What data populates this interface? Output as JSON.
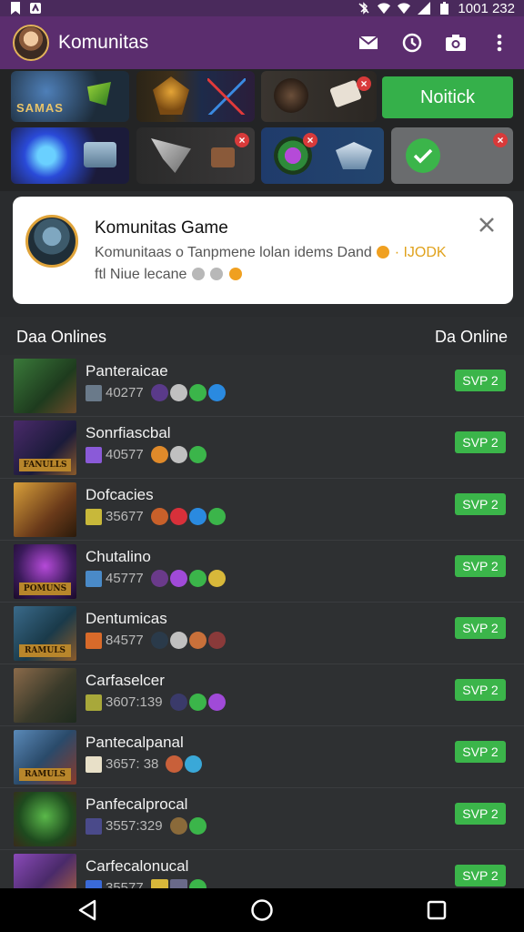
{
  "status_bar": {
    "time": "1001 232",
    "colors": {
      "bg": "#4a2a5c"
    }
  },
  "app_bar": {
    "title": "Komunitas",
    "icons": [
      "mail-icon",
      "clock-icon",
      "camera-icon",
      "more-vert-icon"
    ]
  },
  "tiles": {
    "first_label": "SAMAS",
    "action_button": "Noitick"
  },
  "notification": {
    "title": "Komunitas Game",
    "line1": "Komunitaas o Tanpmene lolan idems Dand",
    "line1_accent": "· IJODK",
    "line2": "ftl  Niue lecane"
  },
  "list_header": {
    "left": "Daa Onlines",
    "right": "Da Online"
  },
  "rows": [
    {
      "name": "Panteraicae",
      "meta": "40277",
      "button": "SVP 2",
      "banner": ""
    },
    {
      "name": "Sonrfiascbal",
      "meta": "40577",
      "button": "SVP 2",
      "banner": "FANULLS"
    },
    {
      "name": "Dofcacies",
      "meta": "35677",
      "button": "SVP 2",
      "banner": ""
    },
    {
      "name": "Chutalino",
      "meta": "45777",
      "button": "SVP 2",
      "banner": "POMUNS"
    },
    {
      "name": "Dentumicas",
      "meta": "84577",
      "button": "SVP 2",
      "banner": "RAMULS"
    },
    {
      "name": "Carfaselcer",
      "meta": "3607:139",
      "button": "SVP 2",
      "banner": ""
    },
    {
      "name": "Pantecalpanal",
      "meta": "3657: 38",
      "button": "SVP 2",
      "banner": "RAMULS"
    },
    {
      "name": "Panfecalprocal",
      "meta": "3557:329",
      "button": "SVP 2",
      "banner": ""
    },
    {
      "name": "Carfecalonucal",
      "meta": "35577",
      "button": "SVP 2",
      "banner": ""
    }
  ],
  "colors": {
    "app_bar": "#5b2d6e",
    "accent_green": "#3bb54a",
    "close_red": "#d83a3a",
    "list_bg": "#2e3032"
  }
}
